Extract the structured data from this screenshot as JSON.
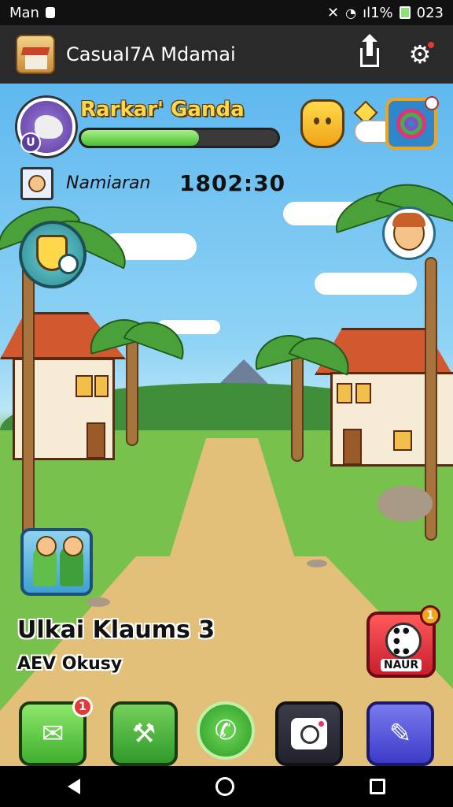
{
  "status_bar": {
    "carrier": "Man",
    "signal_text": "ıl1%",
    "clock": "023",
    "icons": [
      "lock-icon",
      "vibrate-icon",
      "wifi-icon",
      "signal-icon",
      "battery-icon"
    ]
  },
  "app_bar": {
    "title": "CasuaI7A Mdamai",
    "icons": [
      "app-icon",
      "share-icon",
      "gear-icon"
    ],
    "settings_has_notification": true
  },
  "hud": {
    "player_name": "Rarkar' Ganda",
    "player_level": "U",
    "xp_fraction": 0.6,
    "npc_name": "Namiaran",
    "timer": "1802:30"
  },
  "event": {
    "title": "Ulkai Klaums 3",
    "subtitle": "AEV Okusy"
  },
  "buttons": {
    "dice_label": "NAUR",
    "dice_badge": "1",
    "mail_badge": "1"
  },
  "colors": {
    "sky": "#5fb8ef",
    "grass": "#78c14d",
    "path": "#e2c07a",
    "accent_gold": "#ffd84a",
    "accent_red": "#c81e2e"
  }
}
